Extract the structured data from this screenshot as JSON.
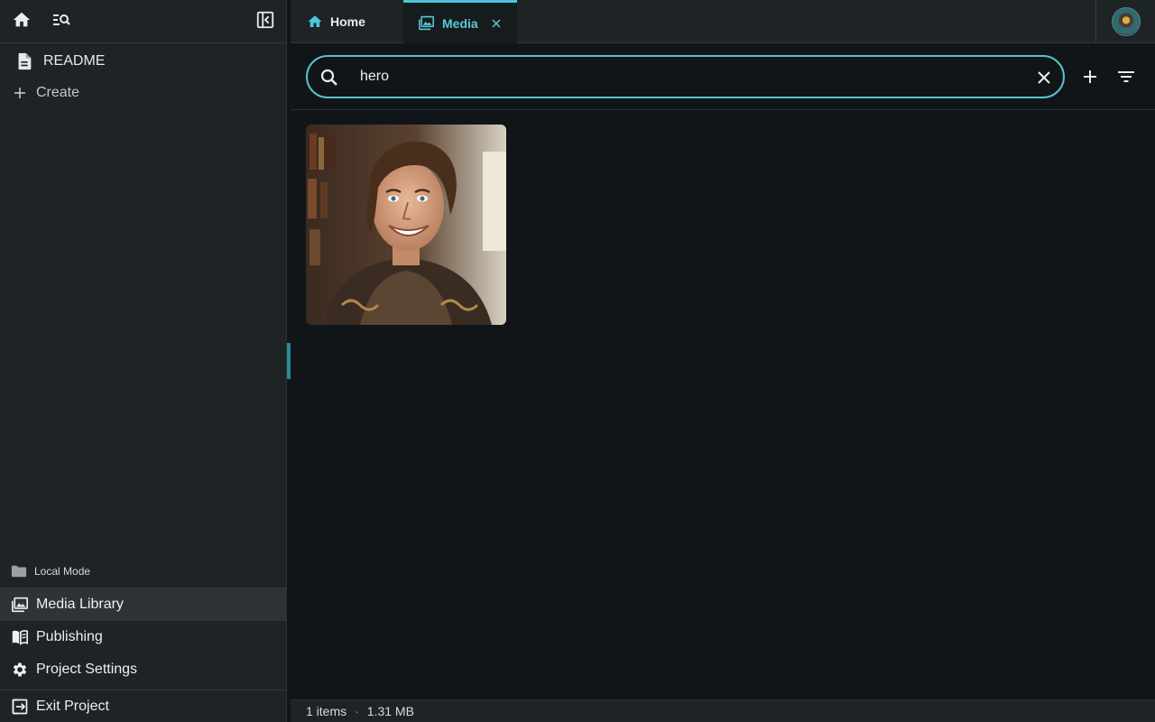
{
  "sidebar": {
    "pages": [
      {
        "label": "README",
        "icon": "document-icon"
      }
    ],
    "create_label": "Create",
    "mode_label": "Local Mode",
    "nav": [
      {
        "label": "Media Library",
        "icon": "image-library-icon",
        "active": true
      },
      {
        "label": "Publishing",
        "icon": "book-icon"
      },
      {
        "label": "Project Settings",
        "icon": "gear-icon"
      },
      {
        "label": "Exit Project",
        "icon": "exit-icon"
      }
    ]
  },
  "tabs": [
    {
      "label": "Home",
      "icon": "home-icon"
    },
    {
      "label": "Media",
      "icon": "image-library-icon",
      "active": true
    }
  ],
  "search": {
    "value": "hero"
  },
  "media": {
    "items": [
      {
        "kind": "image",
        "subject": "smiling young man portrait"
      }
    ]
  },
  "status": {
    "count": "1 items",
    "separator": "·",
    "size": "1.31 MB"
  },
  "colors": {
    "accent": "#4bc6d8",
    "sidebar_bg": "#1e2326",
    "content_bg": "#111517",
    "active_nav_bg": "#2d3337"
  }
}
